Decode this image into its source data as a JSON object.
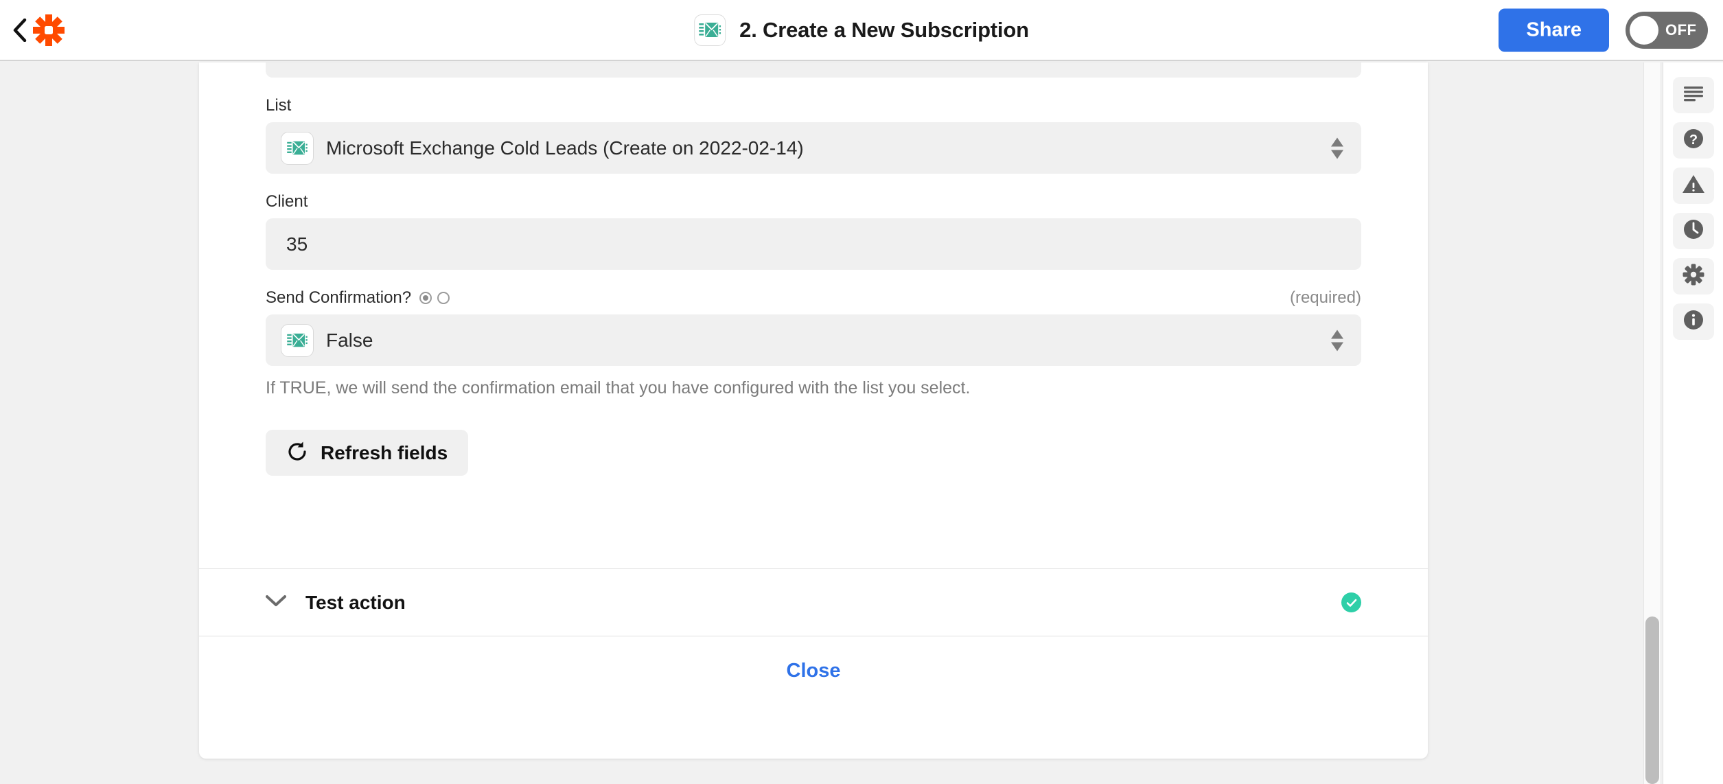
{
  "header": {
    "back_icon": "chevron-left-icon",
    "logo_icon": "zapier-logo-icon",
    "app_icon": "email-envelope-icon",
    "title": "2. Create a New Subscription",
    "share_label": "Share",
    "toggle_label": "OFF",
    "toggle_state": "off",
    "accent_blue": "#2f72e8",
    "logo_orange": "#ff4a00"
  },
  "form": {
    "fields": [
      {
        "label": "List",
        "type": "select",
        "value": "Microsoft Exchange Cold Leads (Create on 2022-02-14)",
        "icon": "email-envelope-icon",
        "required_note": ""
      },
      {
        "label": "Client",
        "type": "text",
        "value": "35",
        "required_note": ""
      },
      {
        "label": "Send Confirmation?",
        "type": "select",
        "value": "False",
        "icon": "email-envelope-icon",
        "required_note": "(required)",
        "help_text": "If TRUE, we will send the confirmation email that you have configured with the list you select."
      }
    ],
    "refresh_button": {
      "label": "Refresh fields",
      "icon": "refresh-icon"
    }
  },
  "test_section": {
    "label": "Test action",
    "chevron_icon": "chevron-down-icon",
    "status_icon": "check-circle-icon",
    "status_color": "#2ecfa8"
  },
  "footer": {
    "close_label": "Close"
  },
  "sidebar": {
    "items": [
      {
        "name": "notes",
        "icon": "lines-icon"
      },
      {
        "name": "help",
        "icon": "question-circle-icon"
      },
      {
        "name": "issues",
        "icon": "warning-triangle-icon"
      },
      {
        "name": "history",
        "icon": "clock-icon"
      },
      {
        "name": "settings",
        "icon": "gear-icon"
      },
      {
        "name": "info",
        "icon": "info-circle-icon"
      }
    ]
  }
}
